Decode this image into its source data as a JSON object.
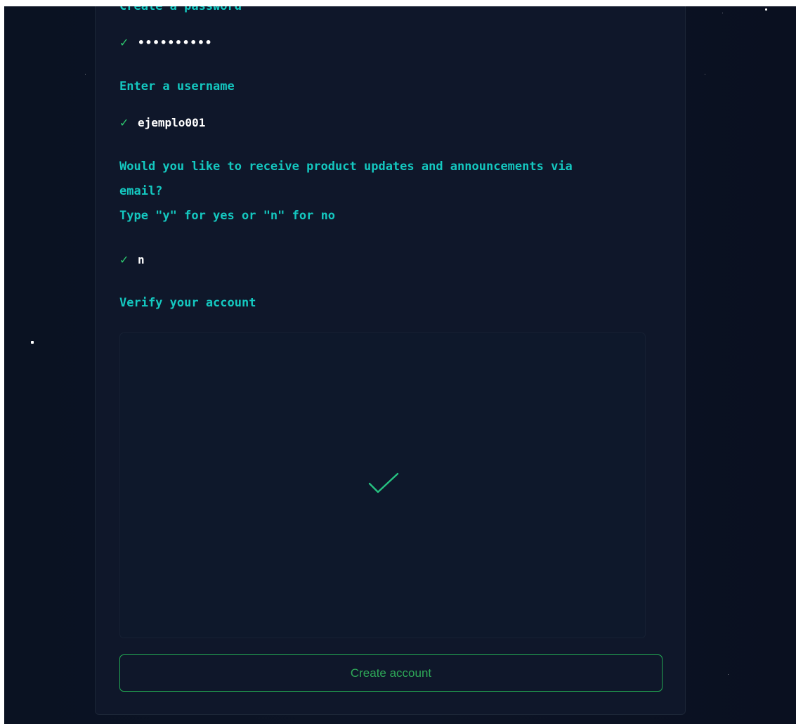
{
  "form": {
    "password": {
      "label": "Create a password",
      "check_icon": "checkmark-icon",
      "value_masked": "••••••••••"
    },
    "username": {
      "label": "Enter a username",
      "check_icon": "checkmark-icon",
      "value": "ejemplo001"
    },
    "updates": {
      "label_line1": "Would you like to receive product updates and announcements via",
      "label_line2": "email?",
      "hint": "Type \"y\" for yes or \"n\" for no",
      "check_icon": "checkmark-icon",
      "value": "n"
    },
    "verify": {
      "label": "Verify your account",
      "status_icon": "large-checkmark-icon"
    },
    "submit_label": "Create account"
  },
  "colors": {
    "background": "#0b1222",
    "card": "#0f172a",
    "label": "#14c8c0",
    "check": "#2ecc71",
    "button_border": "#22a652",
    "button_text": "#2ea958",
    "answer_text": "#ffffff"
  }
}
